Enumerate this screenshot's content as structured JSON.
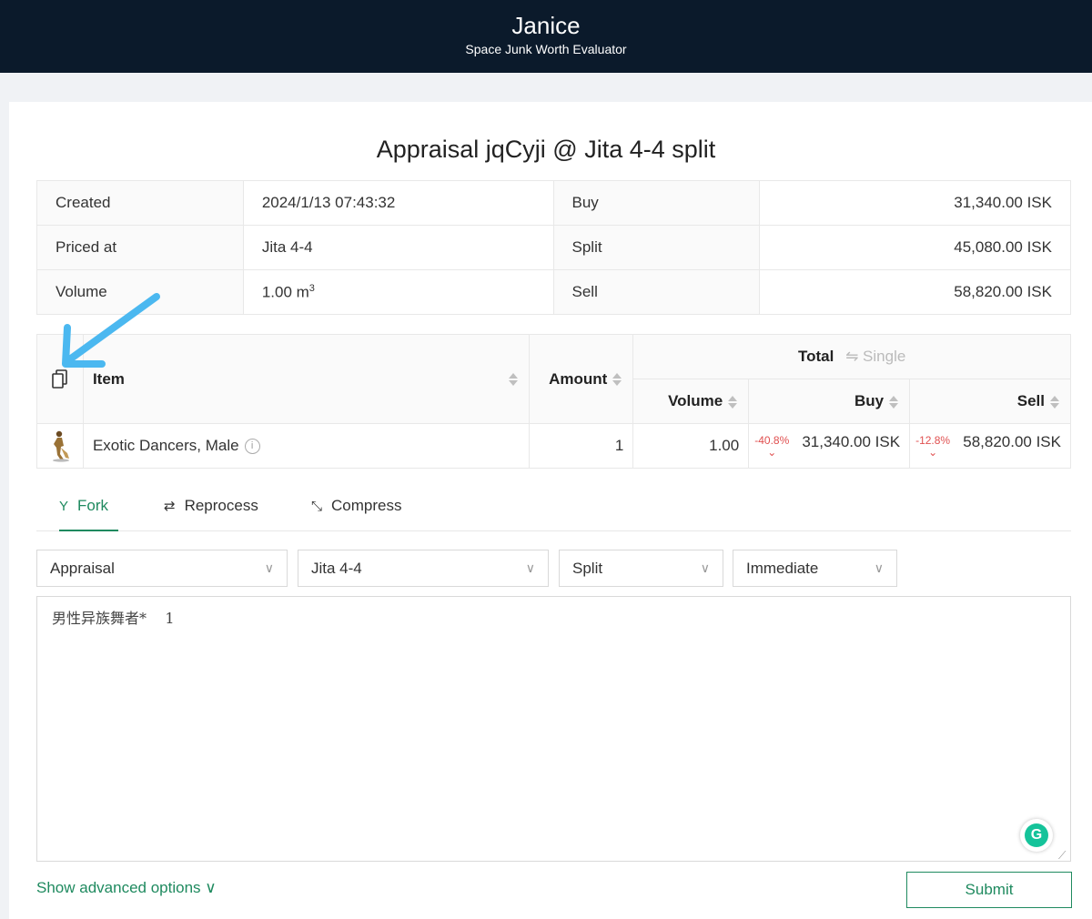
{
  "header": {
    "title": "Janice",
    "subtitle": "Space Junk Worth Evaluator"
  },
  "page_title": "Appraisal jqCyji @ Jita 4-4 split",
  "summary": {
    "created_label": "Created",
    "created_value": "2024/1/13 07:43:32",
    "priced_label": "Priced at",
    "priced_value": "Jita 4-4",
    "volume_label": "Volume",
    "volume_value": "1.00 m",
    "volume_sup": "3",
    "buy_label": "Buy",
    "buy_value": "31,340.00 ISK",
    "split_label": "Split",
    "split_value": "45,080.00 ISK",
    "sell_label": "Sell",
    "sell_value": "58,820.00 ISK"
  },
  "items_table": {
    "headers": {
      "item": "Item",
      "amount": "Amount",
      "total": "Total",
      "single": "Single",
      "volume": "Volume",
      "buy": "Buy",
      "sell": "Sell"
    },
    "rows": [
      {
        "name": "Exotic Dancers, Male",
        "amount": "1",
        "volume": "1.00",
        "buy_delta": "-40.8%",
        "buy": "31,340.00 ISK",
        "sell_delta": "-12.8%",
        "sell": "58,820.00 ISK"
      }
    ]
  },
  "tabs": [
    {
      "label": "Fork",
      "icon": "fork-icon",
      "active": true
    },
    {
      "label": "Reprocess",
      "icon": "repeat-icon",
      "active": false
    },
    {
      "label": "Compress",
      "icon": "compress-icon",
      "active": false
    }
  ],
  "selects": {
    "kind": "Appraisal",
    "market": "Jita 4-4",
    "pricing": "Split",
    "variant": "Immediate"
  },
  "input_text": "男性异族舞者*    1",
  "advanced_label": "Show advanced options",
  "submit_label": "Submit",
  "colors": {
    "accent": "#1f8a5f",
    "header_bg": "#0b1a2b",
    "negative": "#e05050",
    "annotation": "#4bb8f0"
  }
}
